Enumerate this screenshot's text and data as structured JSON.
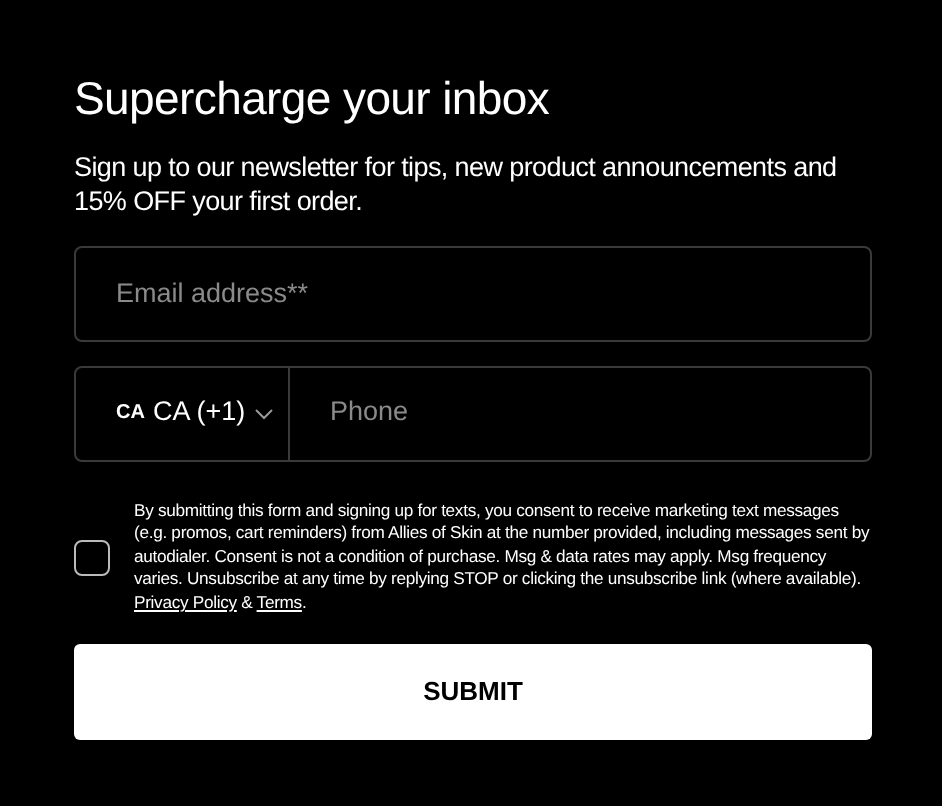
{
  "title": "Supercharge your inbox",
  "intro": "Sign up to our newsletter for tips, new product announcements and 15% OFF your first order.",
  "email": {
    "placeholder": "Email address**"
  },
  "phone": {
    "country_code": "CA",
    "country": "CA (+1)",
    "placeholder": "Phone"
  },
  "consent": {
    "checked": false,
    "parts": [
      {
        "kind": "text",
        "text": "By submitting this form and signing up for texts, you consent to receive marketing text messages (e.g. promos, cart reminders) from Allies of Skin at the number provided, including messages sent by autodialer. Consent is not a condition of purchase. Msg & data rates may apply. Msg frequency varies. Unsubscribe at any time by replying STOP or clicking the unsubscribe link (where available). "
      },
      {
        "kind": "link",
        "text": "Privacy Policy"
      },
      {
        "kind": "text",
        "text": " & "
      },
      {
        "kind": "link",
        "text": "Terms"
      },
      {
        "kind": "text",
        "text": "."
      }
    ]
  },
  "submit": "SUBMIT"
}
